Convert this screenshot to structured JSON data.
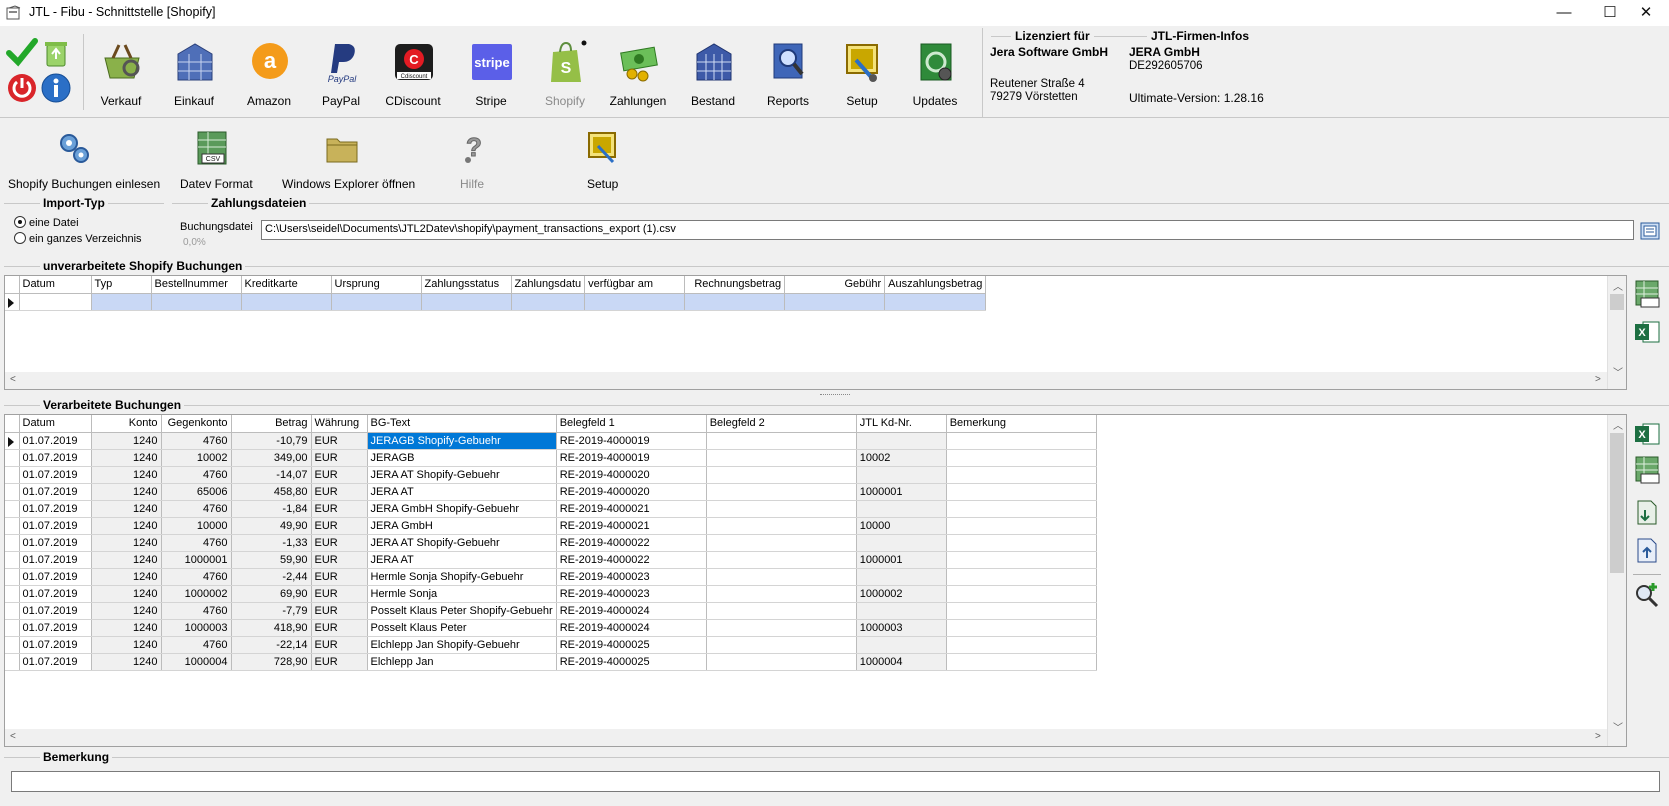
{
  "window": {
    "title": "JTL - Fibu - Schnittstelle [Shopify]",
    "minimize": "—",
    "maximize": "☐",
    "close": "✕"
  },
  "ribbon": {
    "buttons": [
      {
        "label": "Verkauf",
        "icon": "shopping-basket-icon"
      },
      {
        "label": "Einkauf",
        "icon": "warehouse-icon"
      },
      {
        "label": "Amazon",
        "icon": "amazon-icon"
      },
      {
        "label": "PayPal",
        "icon": "paypal-icon"
      },
      {
        "label": "CDiscount",
        "icon": "cdiscount-icon"
      },
      {
        "label": "Stripe",
        "icon": "stripe-icon"
      },
      {
        "label": "Shopify",
        "icon": "shopify-icon"
      },
      {
        "label": "Zahlungen",
        "icon": "money-icon"
      },
      {
        "label": "Bestand",
        "icon": "inventory-icon"
      },
      {
        "label": "Reports",
        "icon": "report-icon"
      },
      {
        "label": "Setup",
        "icon": "setup-icon"
      },
      {
        "label": "Updates",
        "icon": "updates-icon"
      }
    ],
    "icon_text": {
      "amazon": "a",
      "paypal": "PayPal",
      "cdiscount": "Cdiscount",
      "stripe": "stripe"
    }
  },
  "license": {
    "heading": "Lizenziert für",
    "company": "Jera Software GmbH",
    "street": "Reutener Straße 4",
    "city": "79279 Vörstetten",
    "firm_heading": "JTL-Firmen-Infos",
    "firm_name": "JERA GmbH",
    "firm_vat": "DE292605706",
    "version": "Ultimate-Version: 1.28.16"
  },
  "toolbar": {
    "read_bookings": "Shopify Buchungen einlesen",
    "datev_format": "Datev Format",
    "explorer": "Windows Explorer öffnen",
    "help": "Hilfe",
    "setup": "Setup",
    "csv": "CSV"
  },
  "import": {
    "title": "Import-Typ",
    "single_file": "eine Datei",
    "directory": "ein ganzes Verzeichnis",
    "files_title": "Zahlungsdateien",
    "file_label": "Buchungsdatei",
    "progress": "0,0%",
    "file_path": "C:\\Users\\seidel\\Documents\\JTL2Datev\\shopify\\payment_transactions_export (1).csv"
  },
  "unprocessed": {
    "title": "unverarbeitete Shopify Buchungen",
    "columns": [
      "Datum",
      "Typ",
      "Bestellnummer",
      "Kreditkarte",
      "Ursprung",
      "Zahlungsstatus",
      "Zahlungsdatu",
      "verfügbar am",
      "Rechnungsbetrag",
      "Gebühr",
      "Auszahlungsbetrag"
    ]
  },
  "processed": {
    "title": "Verarbeitete Buchungen",
    "columns": [
      "Datum",
      "Konto",
      "Gegenkonto",
      "Betrag",
      "Währung",
      "BG-Text",
      "Belegfeld 1",
      "Belegfeld 2",
      "JTL Kd-Nr.",
      "Bemerkung"
    ],
    "rows": [
      [
        "01.07.2019",
        "1240",
        "4760",
        "-10,79",
        "EUR",
        "JERAGB Shopify-Gebuehr",
        "RE-2019-4000019",
        "",
        "",
        ""
      ],
      [
        "01.07.2019",
        "1240",
        "10002",
        "349,00",
        "EUR",
        "JERAGB",
        "RE-2019-4000019",
        "",
        "10002",
        ""
      ],
      [
        "01.07.2019",
        "1240",
        "4760",
        "-14,07",
        "EUR",
        "JERA AT Shopify-Gebuehr",
        "RE-2019-4000020",
        "",
        "",
        ""
      ],
      [
        "01.07.2019",
        "1240",
        "65006",
        "458,80",
        "EUR",
        "JERA AT",
        "RE-2019-4000020",
        "",
        "1000001",
        ""
      ],
      [
        "01.07.2019",
        "1240",
        "4760",
        "-1,84",
        "EUR",
        "JERA GmbH Shopify-Gebuehr",
        "RE-2019-4000021",
        "",
        "",
        ""
      ],
      [
        "01.07.2019",
        "1240",
        "10000",
        "49,90",
        "EUR",
        "JERA GmbH",
        "RE-2019-4000021",
        "",
        "10000",
        ""
      ],
      [
        "01.07.2019",
        "1240",
        "4760",
        "-1,33",
        "EUR",
        "JERA AT Shopify-Gebuehr",
        "RE-2019-4000022",
        "",
        "",
        ""
      ],
      [
        "01.07.2019",
        "1240",
        "1000001",
        "59,90",
        "EUR",
        "JERA AT",
        "RE-2019-4000022",
        "",
        "1000001",
        ""
      ],
      [
        "01.07.2019",
        "1240",
        "4760",
        "-2,44",
        "EUR",
        "Hermle Sonja Shopify-Gebuehr",
        "RE-2019-4000023",
        "",
        "",
        ""
      ],
      [
        "01.07.2019",
        "1240",
        "1000002",
        "69,90",
        "EUR",
        "Hermle Sonja",
        "RE-2019-4000023",
        "",
        "1000002",
        ""
      ],
      [
        "01.07.2019",
        "1240",
        "4760",
        "-7,79",
        "EUR",
        "Posselt Klaus Peter Shopify-Gebuehr",
        "RE-2019-4000024",
        "",
        "",
        ""
      ],
      [
        "01.07.2019",
        "1240",
        "1000003",
        "418,90",
        "EUR",
        "Posselt Klaus Peter",
        "RE-2019-4000024",
        "",
        "1000003",
        ""
      ],
      [
        "01.07.2019",
        "1240",
        "4760",
        "-22,14",
        "EUR",
        "Elchlepp Jan Shopify-Gebuehr",
        "RE-2019-4000025",
        "",
        "",
        ""
      ],
      [
        "01.07.2019",
        "1240",
        "1000004",
        "728,90",
        "EUR",
        "Elchlepp Jan",
        "RE-2019-4000025",
        "",
        "1000004",
        ""
      ]
    ]
  },
  "remark": {
    "title": "Bemerkung",
    "value": ""
  }
}
